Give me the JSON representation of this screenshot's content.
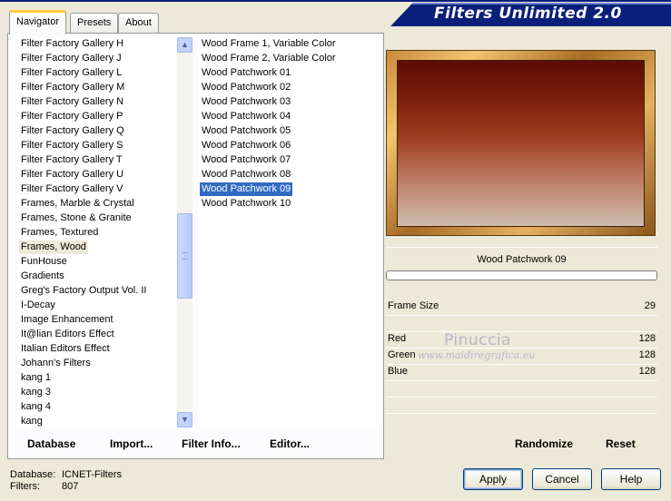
{
  "app": {
    "title": "Filters Unlimited 2.0"
  },
  "tabs": [
    {
      "label": "Navigator",
      "active": true
    },
    {
      "label": "Presets",
      "active": false
    },
    {
      "label": "About",
      "active": false
    }
  ],
  "categories": {
    "items": [
      "Filter Factory Gallery H",
      "Filter Factory Gallery J",
      "Filter Factory Gallery L",
      "Filter Factory Gallery M",
      "Filter Factory Gallery N",
      "Filter Factory Gallery P",
      "Filter Factory Gallery Q",
      "Filter Factory Gallery S",
      "Filter Factory Gallery T",
      "Filter Factory Gallery U",
      "Filter Factory Gallery V",
      "Frames, Marble & Crystal",
      "Frames, Stone & Granite",
      "Frames, Textured",
      "Frames, Wood",
      "FunHouse",
      "Gradients",
      "Greg's Factory Output Vol. II",
      "I-Decay",
      "Image Enhancement",
      "It@lian Editors Effect",
      "Italian Editors Effect",
      "Johann's Filters",
      "kang 1",
      "kang 3",
      "kang 4",
      "kang"
    ],
    "selected": "Frames, Wood"
  },
  "filters": {
    "items": [
      "Wood Frame 1, Variable Color",
      "Wood Frame 2, Variable Color",
      "Wood Patchwork 01",
      "Wood Patchwork 02",
      "Wood Patchwork 03",
      "Wood Patchwork 04",
      "Wood Patchwork 05",
      "Wood Patchwork 06",
      "Wood Patchwork 07",
      "Wood Patchwork 08",
      "Wood Patchwork 09",
      "Wood Patchwork 10"
    ],
    "selected": "Wood Patchwork 09"
  },
  "preview": {
    "filter_name": "Wood Patchwork 09"
  },
  "params": [
    {
      "label": "Frame Size",
      "value": "29"
    },
    {
      "label": "Red",
      "value": "128"
    },
    {
      "label": "Green",
      "value": "128"
    },
    {
      "label": "Blue",
      "value": "128"
    }
  ],
  "watermark": {
    "line1": "Pinuccia",
    "line2": "www.maidiregrafica.eu"
  },
  "toolbar": {
    "database": "Database",
    "import": "Import...",
    "filter_info": "Filter Info...",
    "editor": "Editor...",
    "randomize": "Randomize",
    "reset": "Reset"
  },
  "status": {
    "database_label": "Database:",
    "database_value": "ICNET-Filters",
    "filters_label": "Filters:",
    "filters_value": "807"
  },
  "buttons": {
    "apply": "Apply",
    "cancel": "Cancel",
    "help": "Help"
  }
}
